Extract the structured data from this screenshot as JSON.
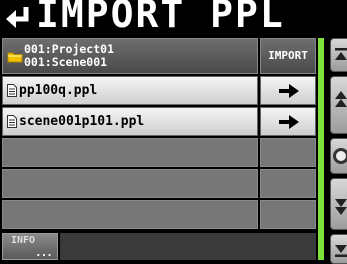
{
  "header": {
    "back_icon": "return-arrow-icon",
    "title": "IMPORT PPL"
  },
  "list": {
    "path_icon": "folder-icon",
    "path_line1": "001:Project01",
    "path_line2": "001:Scene001",
    "import_column": "IMPORT",
    "files": [
      {
        "name": "pp100q.ppl",
        "icon": "file-icon",
        "action_icon": "right-arrow-icon"
      },
      {
        "name": "scene001p101.ppl",
        "icon": "file-icon",
        "action_icon": "right-arrow-icon"
      }
    ]
  },
  "footer": {
    "info_label": "INFO",
    "info_dots": "..."
  },
  "colors": {
    "scroll_bar": "#7ee23a",
    "background": "#000000",
    "row_selected": "#e8e8e8",
    "row_empty": "#777777"
  }
}
